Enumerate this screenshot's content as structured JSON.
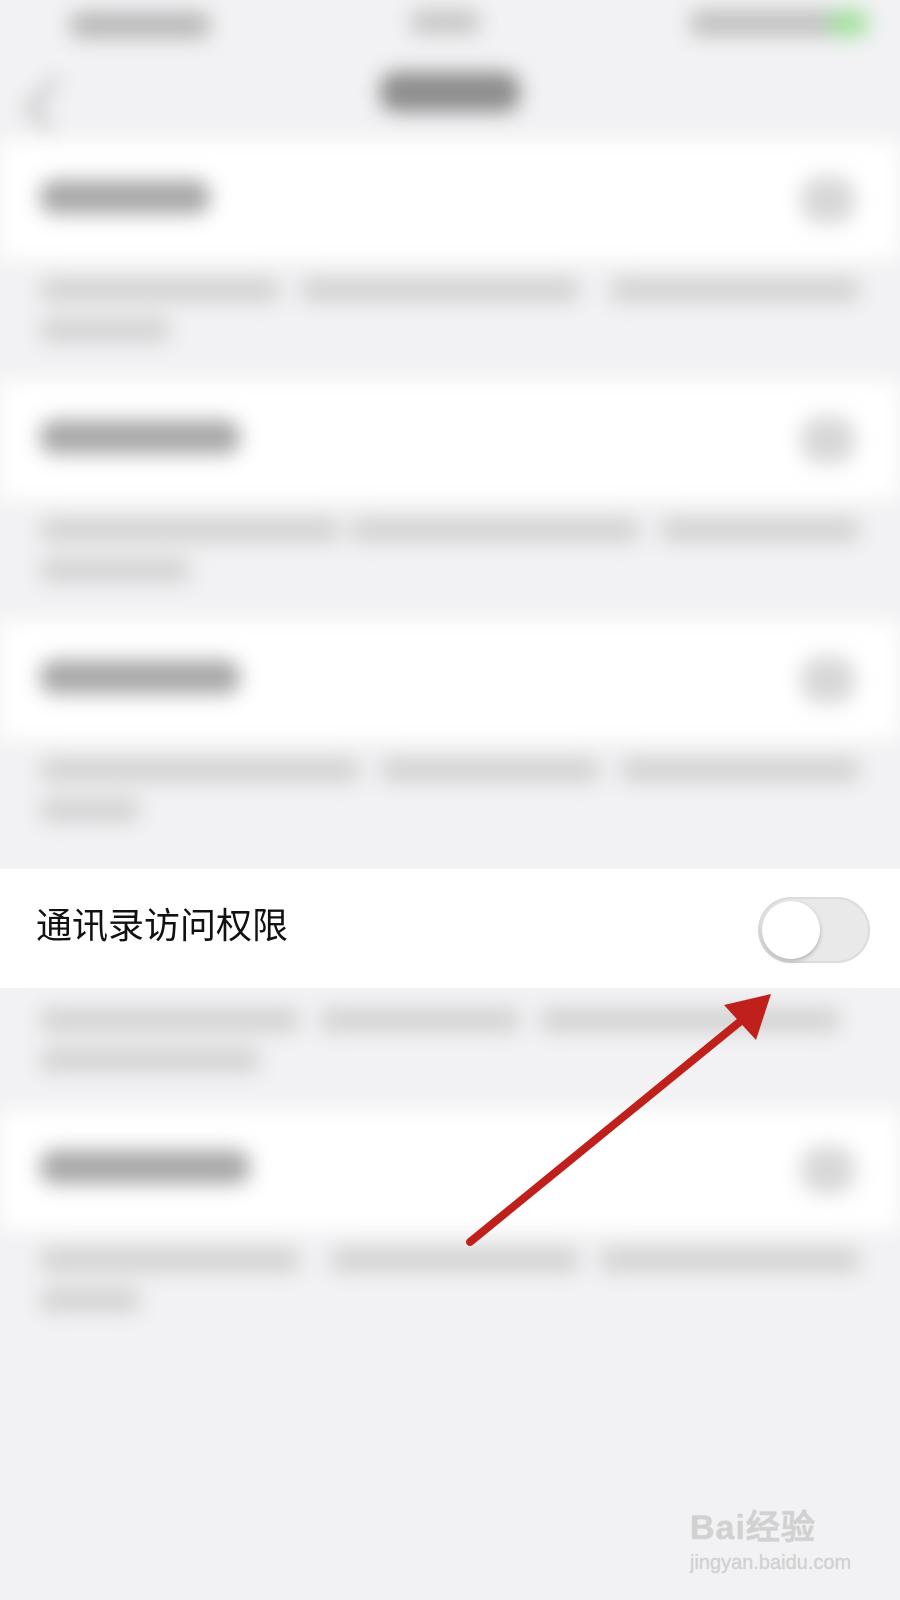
{
  "highlighted_row": {
    "label": "通讯录访问权限",
    "toggle_state": "off"
  },
  "annotation": {
    "arrow_color": "#c0201b"
  },
  "watermark": {
    "brand": "Bai经验",
    "url": "jingyan.baidu.com"
  },
  "colors": {
    "background": "#f2f2f4",
    "row_background": "#ffffff",
    "toggle_off": "#e9e9ea"
  }
}
